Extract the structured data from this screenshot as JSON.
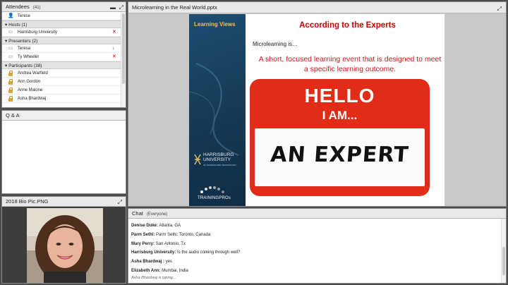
{
  "attendees": {
    "title": "Attendees",
    "count": "(41)",
    "me": "Terese",
    "hosts_label": "Hosts (1)",
    "hosts": [
      "Harrisburg University"
    ],
    "presenters_label": "Presenters (2)",
    "presenters": [
      "Teresa",
      "Ty Wheeler"
    ],
    "participants_label": "Participants (38)",
    "participants": [
      "Andrea Warfield",
      "Ann Gordon",
      "Anne Malone",
      "Asha Bhardwaj"
    ]
  },
  "qa": {
    "title": "Q & A"
  },
  "bio": {
    "title": "2018 Bio Pic.PNG"
  },
  "presentation": {
    "title": "Microlearning in the Real World.pptx",
    "slide": {
      "brand_label": "Learning Views",
      "heading": "According to the Experts",
      "intro": "Microlearning is…",
      "quote": "A short, focused learning event that is designed to meet a specific learning outcome.",
      "tag_hello": "HELLO",
      "tag_iam": "I AM...",
      "tag_name": "AN EXPERT",
      "university_line1": "HARRISBURG",
      "university_line2": "UNIVERSITY",
      "university_sub": "OF SCIENCE AND TECHNOLOGY",
      "partner": "TRAININGPROs"
    }
  },
  "chat": {
    "title": "Chat",
    "scope": "(Everyone)",
    "messages": [
      {
        "name": "Denise Duke:",
        "text": "Atlanta, GA"
      },
      {
        "name": "Parm Sethi:",
        "text": "Parm Sethi: Toronto, Canada"
      },
      {
        "name": "Mary Perry:",
        "text": "San Antonio, Tx"
      },
      {
        "name": "Harrisburg University:",
        "text": "Is the audio coming through well?"
      },
      {
        "name": "Asha Bhardwaj :",
        "text": "yes"
      },
      {
        "name": "Elizabeth Ann:",
        "text": "Mumbai, India"
      }
    ],
    "typing": "Asha Bhardwaj  is typing..."
  },
  "colors": {
    "accent_red": "#cc1a1a",
    "slide_blue": "#163d5b",
    "tag_red": "#e12d18",
    "brand_gold": "#f2c049"
  }
}
